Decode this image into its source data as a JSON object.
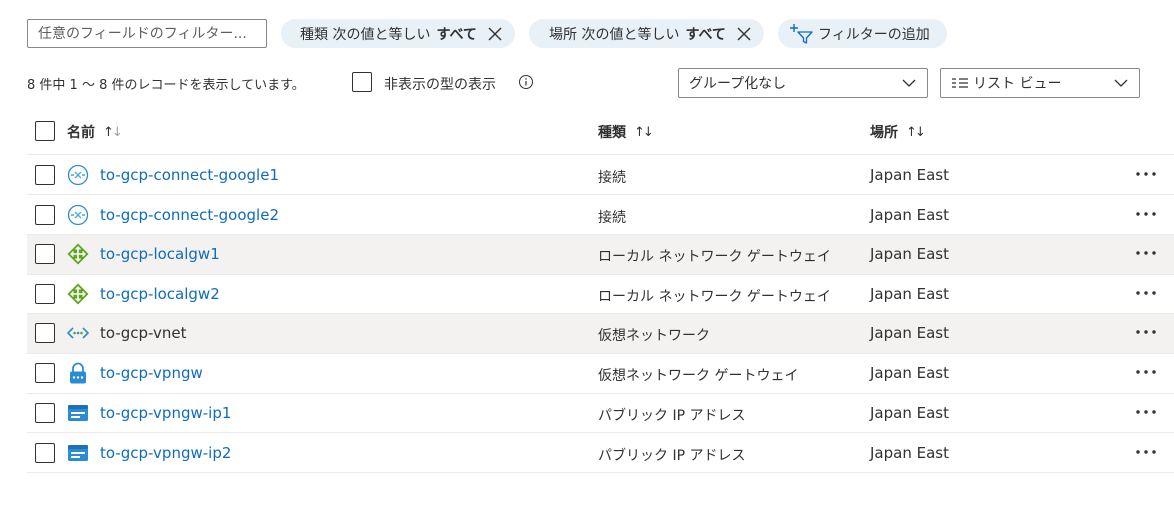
{
  "filter": {
    "placeholder": "任意のフィールドのフィルター..."
  },
  "pills": [
    {
      "field": "種類 次の値と等しい",
      "value": "すべて"
    },
    {
      "field": "場所 次の値と等しい",
      "value": "すべて"
    }
  ],
  "add_filter_label": "フィルターの追加",
  "summary": "8 件中 1 ～ 8 件のレコードを表示しています。",
  "show_hidden_label": "非表示の型の表示",
  "group_dropdown": {
    "selected": "グループ化なし"
  },
  "view_dropdown": {
    "selected": "リスト ビュー"
  },
  "columns": {
    "name": "名前",
    "type": "種類",
    "location": "場所"
  },
  "rows": [
    {
      "name": "to-gcp-connect-google1",
      "type": "接続",
      "location": "Japan East",
      "icon": "connection-icon"
    },
    {
      "name": "to-gcp-connect-google2",
      "type": "接続",
      "location": "Japan East",
      "icon": "connection-icon"
    },
    {
      "name": "to-gcp-localgw1",
      "type": "ローカル ネットワーク ゲートウェイ",
      "location": "Japan East",
      "icon": "local-network-gateway-icon"
    },
    {
      "name": "to-gcp-localgw2",
      "type": "ローカル ネットワーク ゲートウェイ",
      "location": "Japan East",
      "icon": "local-network-gateway-icon"
    },
    {
      "name": "to-gcp-vnet",
      "type": "仮想ネットワーク",
      "location": "Japan East",
      "icon": "virtual-network-icon"
    },
    {
      "name": "to-gcp-vpngw",
      "type": "仮想ネットワーク ゲートウェイ",
      "location": "Japan East",
      "icon": "vpn-gateway-icon"
    },
    {
      "name": "to-gcp-vpngw-ip1",
      "type": "パブリック IP アドレス",
      "location": "Japan East",
      "icon": "public-ip-icon"
    },
    {
      "name": "to-gcp-vpngw-ip2",
      "type": "パブリック IP アドレス",
      "location": "Japan East",
      "icon": "public-ip-icon"
    }
  ],
  "colors": {
    "link": "#0f6cbd",
    "pill_bg": "#e8f0f8",
    "row_highlight": "#f3f2f1"
  }
}
